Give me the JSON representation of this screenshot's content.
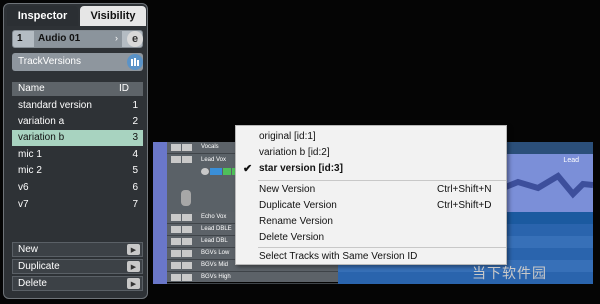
{
  "inspector": {
    "tabs": [
      {
        "label": "Inspector"
      },
      {
        "label": "Visibility"
      }
    ],
    "track": {
      "number": "1",
      "name": "Audio 01",
      "arrow": "›",
      "edit_glyph": "e"
    },
    "section_title": "TrackVersions",
    "columns": {
      "name": "Name",
      "id": "ID"
    },
    "versions": [
      {
        "name": "standard version",
        "id": "1"
      },
      {
        "name": "variation a",
        "id": "2"
      },
      {
        "name": "variation b",
        "id": "3"
      },
      {
        "name": "mic 1",
        "id": "4"
      },
      {
        "name": "mic 2",
        "id": "5"
      },
      {
        "name": "v6",
        "id": "6"
      },
      {
        "name": "v7",
        "id": "7"
      }
    ],
    "selected_index": 2,
    "actions": [
      {
        "label": "New"
      },
      {
        "label": "Duplicate"
      },
      {
        "label": "Delete"
      }
    ]
  },
  "tracks": [
    {
      "name": "Vocals"
    },
    {
      "name": "Lead Vox"
    },
    {
      "name": "Echo Vox"
    },
    {
      "name": "Lead DBLE"
    },
    {
      "name": "Lead DBL"
    },
    {
      "name": "BGVs Low"
    },
    {
      "name": "BGVs Mid"
    },
    {
      "name": "BGVs High"
    }
  ],
  "arrange": {
    "event_label": "Lead"
  },
  "menu": {
    "versions": [
      {
        "label": "original [id:1]",
        "checked": false
      },
      {
        "label": "variation b [id:2]",
        "checked": false
      },
      {
        "label": "star version [id:3]",
        "checked": true
      }
    ],
    "commands": [
      {
        "label": "New Version",
        "shortcut": "Ctrl+Shift+N"
      },
      {
        "label": "Duplicate Version",
        "shortcut": "Ctrl+Shift+D"
      },
      {
        "label": "Rename Version",
        "shortcut": ""
      },
      {
        "label": "Delete Version",
        "shortcut": ""
      }
    ],
    "select_tracks": {
      "label": "Select Tracks with Same Version ID"
    },
    "check_glyph": "✔"
  },
  "watermark": "当下软件园",
  "colors": {
    "selected_row": "#a8d3c0",
    "track_tab": "#6a77c9",
    "accent_blue": "#5a93c8"
  }
}
